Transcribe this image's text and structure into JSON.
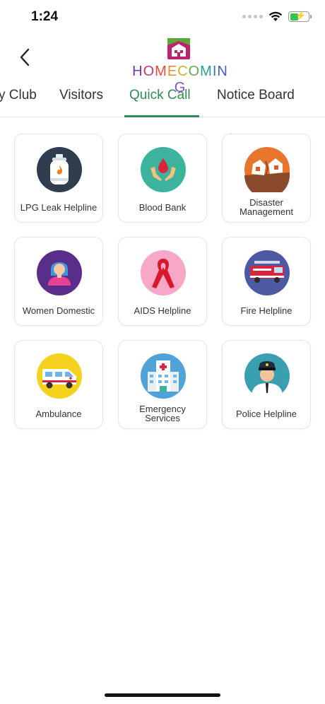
{
  "status_bar": {
    "time": "1:24"
  },
  "header": {
    "logo_text": [
      "H",
      "O",
      "M",
      "E",
      "C",
      "O",
      "M",
      "I",
      "N",
      "G"
    ],
    "logo_colors": [
      "#6b3fa0",
      "#c0397a",
      "#e04b3a",
      "#e98c2a",
      "#d8b126",
      "#6aa84f",
      "#2a9d8f",
      "#2b7bb9",
      "#4a5cc4",
      "#8a4fc6"
    ],
    "logo_house_color": "#c0216d",
    "logo_roof_color": "#5aa83a"
  },
  "tabs": [
    {
      "label": "y Club"
    },
    {
      "label": "Visitors"
    },
    {
      "label": "Quick Call",
      "active": true
    },
    {
      "label": "Notice Board"
    }
  ],
  "accent_color": "#2e8b57",
  "services": [
    {
      "label": "LPG Leak Helpline",
      "icon": "gas-cylinder-icon",
      "bg": "#2f3d4f"
    },
    {
      "label": "Blood Bank",
      "icon": "blood-drop-hands-icon",
      "bg": "#3db39e"
    },
    {
      "label": "Disaster Management",
      "icon": "disaster-house-icon",
      "bg": "#e8752c"
    },
    {
      "label": "Women Domestic",
      "icon": "woman-icon",
      "bg": "#5b2d8a"
    },
    {
      "label": "AIDS Helpline",
      "icon": "red-ribbon-icon",
      "bg": "#f7a8c8"
    },
    {
      "label": "Fire Helpline",
      "icon": "fire-truck-icon",
      "bg": "#4d5aa3"
    },
    {
      "label": "Ambulance",
      "icon": "ambulance-icon",
      "bg": "#f4d21f"
    },
    {
      "label": "Emergency Services",
      "icon": "hospital-icon",
      "bg": "#4fa3d9"
    },
    {
      "label": "Police Helpline",
      "icon": "police-officer-icon",
      "bg": "#3a9fb0"
    }
  ]
}
